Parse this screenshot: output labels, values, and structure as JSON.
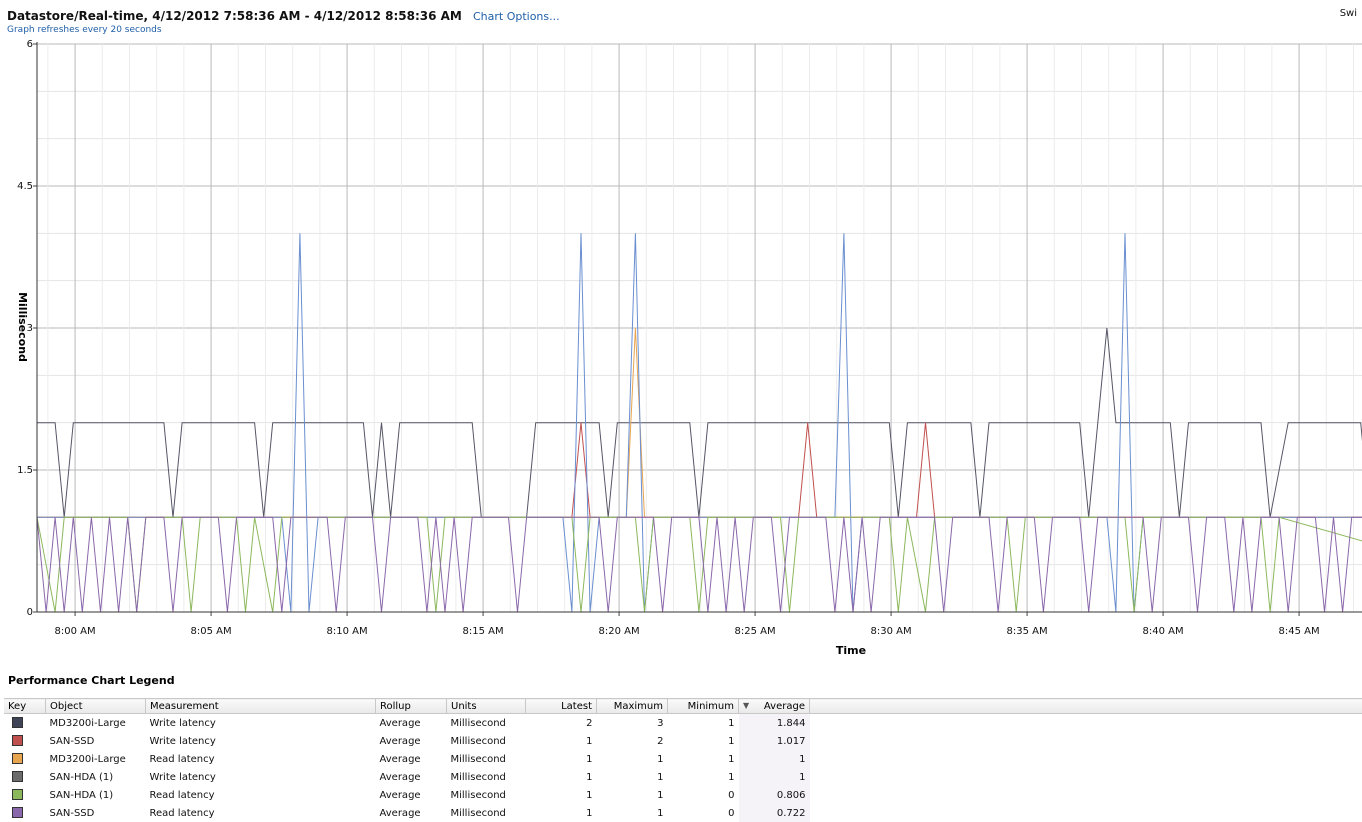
{
  "header": {
    "title": "Datastore/Real-time, 4/12/2012 7:58:36 AM - 4/12/2012 8:58:36 AM",
    "chart_options_link": "Chart Options...",
    "refresh_note": "Graph refreshes every 20 seconds",
    "switch_link": "Swi"
  },
  "chart_data": {
    "type": "line",
    "xlabel": "Time",
    "ylabel": "Millisecond",
    "ylim": [
      0,
      6
    ],
    "yticks": [
      "0",
      "1.5",
      "3",
      "4.5",
      "6"
    ],
    "xticks": [
      "8:00 AM",
      "8:05 AM",
      "8:10 AM",
      "8:15 AM",
      "8:20 AM",
      "8:25 AM",
      "8:30 AM",
      "8:35 AM",
      "8:40 AM",
      "8:45 AM"
    ],
    "grid": true,
    "start_time": "7:58:36 AM",
    "end_time": "8:58:36 AM",
    "series": [
      {
        "color": "#555566",
        "points": [
          [
            "7:58:36",
            2
          ],
          [
            "7:59:16",
            2
          ],
          [
            "7:59:36",
            1
          ],
          [
            "7:59:56",
            2
          ],
          [
            "8:03:16",
            2
          ],
          [
            "8:03:36",
            1
          ],
          [
            "8:03:56",
            2
          ],
          [
            "8:06:36",
            2
          ],
          [
            "8:06:56",
            1
          ],
          [
            "8:07:16",
            2
          ],
          [
            "8:10:36",
            2
          ],
          [
            "8:10:56",
            1
          ],
          [
            "8:11:16",
            2
          ],
          [
            "8:11:36",
            1
          ],
          [
            "8:11:56",
            2
          ],
          [
            "8:14:36",
            2
          ],
          [
            "8:14:56",
            1
          ],
          [
            "8:16:36",
            1
          ],
          [
            "8:16:56",
            2
          ],
          [
            "8:19:16",
            2
          ],
          [
            "8:19:36",
            1
          ],
          [
            "8:19:56",
            2
          ],
          [
            "8:22:36",
            2
          ],
          [
            "8:22:56",
            1
          ],
          [
            "8:23:16",
            2
          ],
          [
            "8:29:56",
            2
          ],
          [
            "8:30:16",
            1
          ],
          [
            "8:30:36",
            2
          ],
          [
            "8:32:56",
            2
          ],
          [
            "8:33:16",
            1
          ],
          [
            "8:33:36",
            2
          ],
          [
            "8:36:56",
            2
          ],
          [
            "8:37:16",
            1
          ],
          [
            "8:37:56",
            3
          ],
          [
            "8:38:16",
            2
          ],
          [
            "8:40:16",
            2
          ],
          [
            "8:40:36",
            1
          ],
          [
            "8:40:56",
            2
          ],
          [
            "8:43:36",
            2
          ],
          [
            "8:43:56",
            1
          ],
          [
            "8:44:36",
            2
          ],
          [
            "8:47:16",
            2
          ],
          [
            "8:47:36",
            1
          ],
          [
            "8:47:56",
            1
          ]
        ]
      },
      {
        "color": "#c0504d",
        "points": [
          [
            "7:58:36",
            1
          ],
          [
            "8:18:16",
            1
          ],
          [
            "8:18:36",
            2
          ],
          [
            "8:18:56",
            1
          ],
          [
            "8:26:36",
            1
          ],
          [
            "8:26:56",
            2
          ],
          [
            "8:27:16",
            1
          ],
          [
            "8:30:56",
            1
          ],
          [
            "8:31:16",
            2
          ],
          [
            "8:31:36",
            1
          ],
          [
            "8:47:56",
            1
          ]
        ]
      },
      {
        "color": "#e8a550",
        "points": [
          [
            "7:58:36",
            1
          ],
          [
            "8:20:16",
            1
          ],
          [
            "8:20:36",
            3
          ],
          [
            "8:20:56",
            1
          ],
          [
            "8:47:56",
            1
          ]
        ]
      },
      {
        "color": "#6a8fd0",
        "points": [
          [
            "7:58:36",
            1
          ],
          [
            "8:07:36",
            1
          ],
          [
            "8:07:56",
            0
          ],
          [
            "8:08:16",
            4
          ],
          [
            "8:08:36",
            0
          ],
          [
            "8:08:56",
            1
          ],
          [
            "8:17:56",
            1
          ],
          [
            "8:18:16",
            0
          ],
          [
            "8:18:36",
            4
          ],
          [
            "8:18:56",
            0
          ],
          [
            "8:19:16",
            1
          ],
          [
            "8:20:16",
            1
          ],
          [
            "8:20:36",
            4
          ],
          [
            "8:20:56",
            0
          ],
          [
            "8:21:16",
            1
          ],
          [
            "8:27:56",
            1
          ],
          [
            "8:28:16",
            4
          ],
          [
            "8:28:36",
            0
          ],
          [
            "8:28:56",
            1
          ],
          [
            "8:37:56",
            1
          ],
          [
            "8:38:16",
            0
          ],
          [
            "8:38:36",
            4
          ],
          [
            "8:38:56",
            0
          ],
          [
            "8:39:16",
            1
          ],
          [
            "8:47:56",
            1
          ]
        ]
      },
      {
        "color": "#8cb85c",
        "points": [
          [
            "7:58:36",
            1
          ],
          [
            "7:59:16",
            0
          ],
          [
            "7:59:36",
            1
          ],
          [
            "8:01:56",
            1
          ],
          [
            "8:02:16",
            0
          ],
          [
            "8:02:36",
            1
          ],
          [
            "8:03:56",
            1
          ],
          [
            "8:04:16",
            0
          ],
          [
            "8:04:36",
            1
          ],
          [
            "8:05:56",
            1
          ],
          [
            "8:06:16",
            0
          ],
          [
            "8:06:36",
            1
          ],
          [
            "8:07:16",
            0
          ],
          [
            "8:07:36",
            1
          ],
          [
            "8:12:56",
            1
          ],
          [
            "8:13:16",
            0
          ],
          [
            "8:13:36",
            1
          ],
          [
            "8:18:16",
            1
          ],
          [
            "8:18:36",
            0
          ],
          [
            "8:18:56",
            1
          ],
          [
            "8:20:36",
            1
          ],
          [
            "8:20:56",
            0
          ],
          [
            "8:21:16",
            1
          ],
          [
            "8:22:36",
            1
          ],
          [
            "8:22:56",
            0
          ],
          [
            "8:23:16",
            1
          ],
          [
            "8:25:56",
            1
          ],
          [
            "8:26:16",
            0
          ],
          [
            "8:26:36",
            1
          ],
          [
            "8:29:56",
            1
          ],
          [
            "8:30:16",
            0
          ],
          [
            "8:30:36",
            1
          ],
          [
            "8:31:16",
            0
          ],
          [
            "8:31:36",
            1
          ],
          [
            "8:34:16",
            1
          ],
          [
            "8:34:36",
            0
          ],
          [
            "8:34:56",
            1
          ],
          [
            "8:38:36",
            1
          ],
          [
            "8:38:56",
            0
          ],
          [
            "8:39:16",
            1
          ],
          [
            "8:43:36",
            1
          ],
          [
            "8:43:56",
            0
          ],
          [
            "8:44:16",
            1
          ],
          [
            "8:47:56",
            0.7
          ]
        ]
      },
      {
        "color": "#8a67aa",
        "points": [
          [
            "7:58:36",
            1
          ],
          [
            "7:58:56",
            0
          ],
          [
            "7:59:16",
            1
          ],
          [
            "7:59:36",
            0
          ],
          [
            "7:59:56",
            1
          ],
          [
            "8:00:16",
            0
          ],
          [
            "8:00:36",
            1
          ],
          [
            "8:00:56",
            0
          ],
          [
            "8:01:16",
            1
          ],
          [
            "8:01:36",
            0
          ],
          [
            "8:01:56",
            1
          ],
          [
            "8:02:16",
            0
          ],
          [
            "8:02:36",
            1
          ],
          [
            "8:03:16",
            1
          ],
          [
            "8:03:36",
            0
          ],
          [
            "8:03:56",
            1
          ],
          [
            "8:05:16",
            1
          ],
          [
            "8:05:36",
            0
          ],
          [
            "8:05:56",
            1
          ],
          [
            "8:07:16",
            1
          ],
          [
            "8:07:36",
            0
          ],
          [
            "8:07:56",
            1
          ],
          [
            "8:09:16",
            1
          ],
          [
            "8:09:36",
            0
          ],
          [
            "8:09:56",
            1
          ],
          [
            "8:10:56",
            1
          ],
          [
            "8:11:16",
            0
          ],
          [
            "8:11:36",
            1
          ],
          [
            "8:12:36",
            1
          ],
          [
            "8:12:56",
            0
          ],
          [
            "8:13:16",
            1
          ],
          [
            "8:13:36",
            0
          ],
          [
            "8:13:56",
            1
          ],
          [
            "8:14:16",
            0
          ],
          [
            "8:14:36",
            1
          ],
          [
            "8:15:56",
            1
          ],
          [
            "8:16:16",
            0
          ],
          [
            "8:16:36",
            1
          ],
          [
            "8:19:16",
            1
          ],
          [
            "8:19:36",
            0
          ],
          [
            "8:19:56",
            1
          ],
          [
            "8:21:16",
            1
          ],
          [
            "8:21:36",
            0
          ],
          [
            "8:21:56",
            1
          ],
          [
            "8:22:56",
            1
          ],
          [
            "8:23:16",
            0
          ],
          [
            "8:23:36",
            1
          ],
          [
            "8:23:56",
            0
          ],
          [
            "8:24:16",
            1
          ],
          [
            "8:24:36",
            0
          ],
          [
            "8:24:56",
            1
          ],
          [
            "8:25:36",
            1
          ],
          [
            "8:25:56",
            0
          ],
          [
            "8:26:16",
            1
          ],
          [
            "8:27:36",
            1
          ],
          [
            "8:27:56",
            0
          ],
          [
            "8:28:16",
            1
          ],
          [
            "8:28:36",
            0
          ],
          [
            "8:28:56",
            1
          ],
          [
            "8:29:16",
            0
          ],
          [
            "8:29:36",
            1
          ],
          [
            "8:31:36",
            1
          ],
          [
            "8:31:56",
            0
          ],
          [
            "8:32:16",
            1
          ],
          [
            "8:33:36",
            1
          ],
          [
            "8:33:56",
            0
          ],
          [
            "8:34:16",
            1
          ],
          [
            "8:35:16",
            1
          ],
          [
            "8:35:36",
            0
          ],
          [
            "8:35:56",
            1
          ],
          [
            "8:36:56",
            1
          ],
          [
            "8:37:16",
            0
          ],
          [
            "8:37:36",
            1
          ],
          [
            "8:39:16",
            1
          ],
          [
            "8:39:36",
            0
          ],
          [
            "8:39:56",
            1
          ],
          [
            "8:40:56",
            1
          ],
          [
            "8:41:16",
            0
          ],
          [
            "8:41:36",
            1
          ],
          [
            "8:42:16",
            1
          ],
          [
            "8:42:36",
            0
          ],
          [
            "8:42:56",
            1
          ],
          [
            "8:43:16",
            0
          ],
          [
            "8:43:36",
            1
          ],
          [
            "8:44:16",
            1
          ],
          [
            "8:44:36",
            0
          ],
          [
            "8:44:56",
            1
          ],
          [
            "8:45:36",
            1
          ],
          [
            "8:45:56",
            0
          ],
          [
            "8:46:16",
            1
          ],
          [
            "8:46:36",
            0
          ],
          [
            "8:46:56",
            1
          ],
          [
            "8:47:56",
            1
          ]
        ]
      },
      {
        "color": "#5e5e5e",
        "points": [
          [
            "7:58:36",
            0
          ],
          [
            "8:47:56",
            0
          ]
        ]
      }
    ]
  },
  "legend": {
    "title": "Performance Chart Legend",
    "columns": [
      "Key",
      "Object",
      "Measurement",
      "Rollup",
      "Units",
      "Latest",
      "Maximum",
      "Minimum",
      "Average"
    ],
    "rows": [
      {
        "color": "#3f4457",
        "object": "MD3200i-Large",
        "measurement": "Write latency",
        "rollup": "Average",
        "units": "Millisecond",
        "latest": "2",
        "maximum": "3",
        "minimum": "1",
        "average": "1.844"
      },
      {
        "color": "#c0504d",
        "object": "SAN-SSD",
        "measurement": "Write latency",
        "rollup": "Average",
        "units": "Millisecond",
        "latest": "1",
        "maximum": "2",
        "minimum": "1",
        "average": "1.017"
      },
      {
        "color": "#e8a550",
        "object": "MD3200i-Large",
        "measurement": "Read latency",
        "rollup": "Average",
        "units": "Millisecond",
        "latest": "1",
        "maximum": "1",
        "minimum": "1",
        "average": "1"
      },
      {
        "color": "#6b6b6b",
        "object": "SAN-HDA (1)",
        "measurement": "Write latency",
        "rollup": "Average",
        "units": "Millisecond",
        "latest": "1",
        "maximum": "1",
        "minimum": "1",
        "average": "1"
      },
      {
        "color": "#8cb85c",
        "object": "SAN-HDA (1)",
        "measurement": "Read latency",
        "rollup": "Average",
        "units": "Millisecond",
        "latest": "1",
        "maximum": "1",
        "minimum": "0",
        "average": "0.806"
      },
      {
        "color": "#8a67aa",
        "object": "SAN-SSD",
        "measurement": "Read latency",
        "rollup": "Average",
        "units": "Millisecond",
        "latest": "1",
        "maximum": "1",
        "minimum": "0",
        "average": "0.722"
      }
    ]
  }
}
